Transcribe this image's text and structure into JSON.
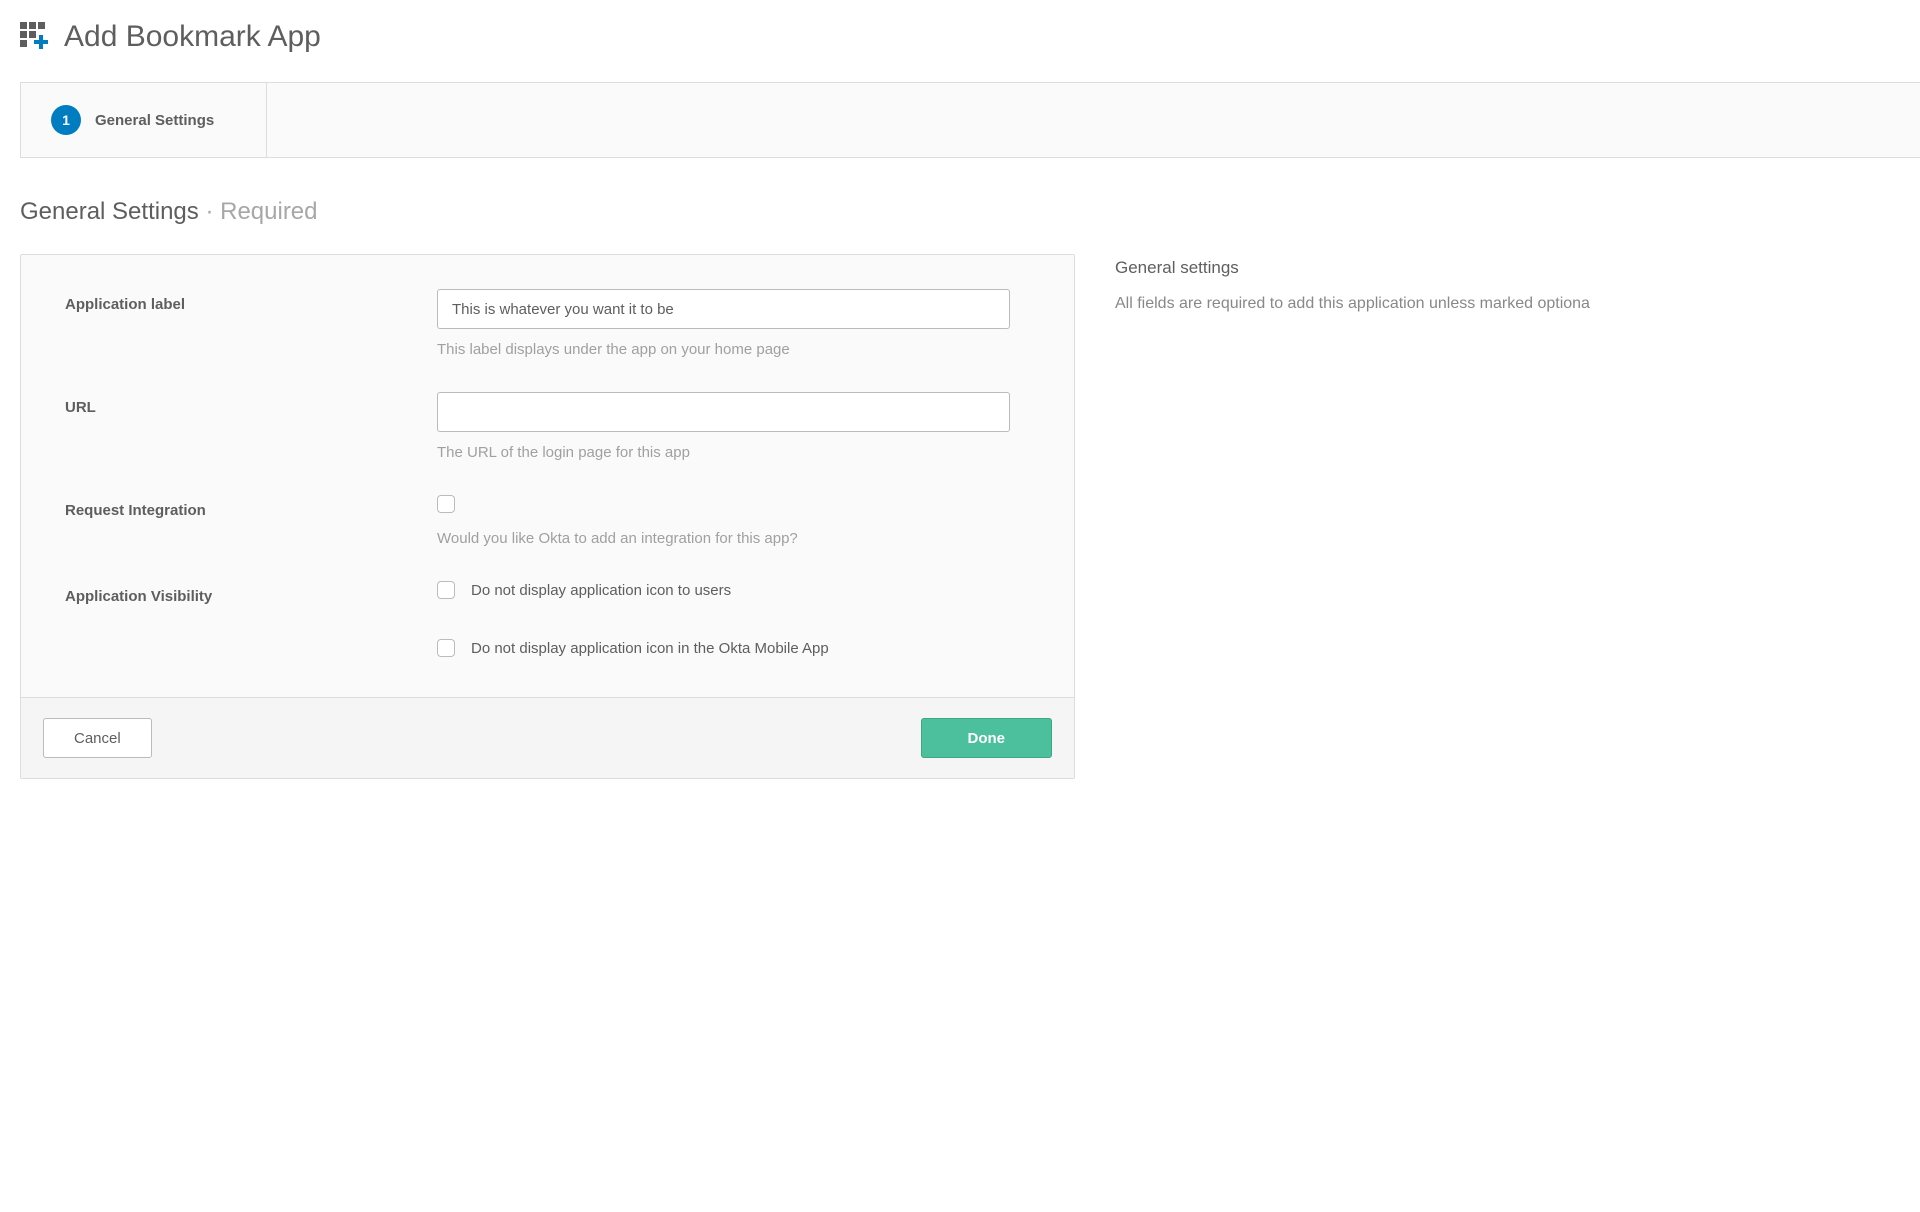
{
  "header": {
    "title": "Add Bookmark App"
  },
  "wizard": {
    "steps": [
      {
        "number": "1",
        "label": "General Settings"
      }
    ]
  },
  "section": {
    "title": "General Settings",
    "separator": " · ",
    "qualifier": "Required"
  },
  "form": {
    "application_label": {
      "label": "Application label",
      "value": "This is whatever you want it to be",
      "help": "This label displays under the app on your home page"
    },
    "url": {
      "label": "URL",
      "value": "",
      "help": "The URL of the login page for this app"
    },
    "request_integration": {
      "label": "Request Integration",
      "checked": false,
      "help": "Would you like Okta to add an integration for this app?"
    },
    "application_visibility": {
      "label": "Application Visibility",
      "options": [
        {
          "label": "Do not display application icon to users",
          "checked": false
        },
        {
          "label": "Do not display application icon in the Okta Mobile App",
          "checked": false
        }
      ]
    }
  },
  "footer": {
    "cancel": "Cancel",
    "done": "Done"
  },
  "sidebar": {
    "title": "General settings",
    "text": "All fields are required to add this application unless marked optiona"
  }
}
